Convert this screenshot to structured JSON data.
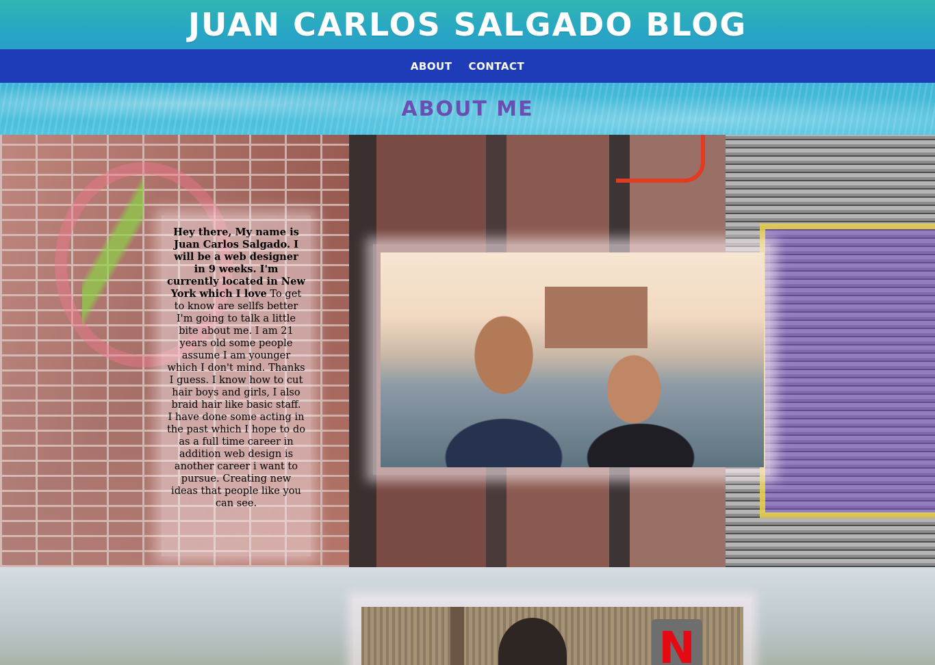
{
  "header": {
    "title": "Juan Carlos Salgado Blog"
  },
  "nav": {
    "items": [
      {
        "label": "About"
      },
      {
        "label": "Contact"
      }
    ]
  },
  "about": {
    "heading": "About Me",
    "bio_bold": "Hey there, My name is Juan Carlos Salgado. I will be a web designer in 9 weeks. I'm currently located in New York which I love",
    "bio_text_1": " To get to know are sellfs better I'm going to talk a little bite about me. I am 21 years old some people assume I am younger which I don't mind. Thanks I guess. I know how to cut hair boys and girls, I also braid hair like basic staff.",
    "bio_text_2": "I have done some acting in the past which I hope to do as a full time career in addition web design is another career i want to pursue. Creating new ideas that people like you can see."
  },
  "bottom": {
    "logo_letter": "N"
  },
  "colors": {
    "header_bg": "#2aa9c2",
    "nav_bg": "#1e3bb8",
    "about_heading": "#6a4fb3",
    "netflix_red": "#e50914"
  }
}
